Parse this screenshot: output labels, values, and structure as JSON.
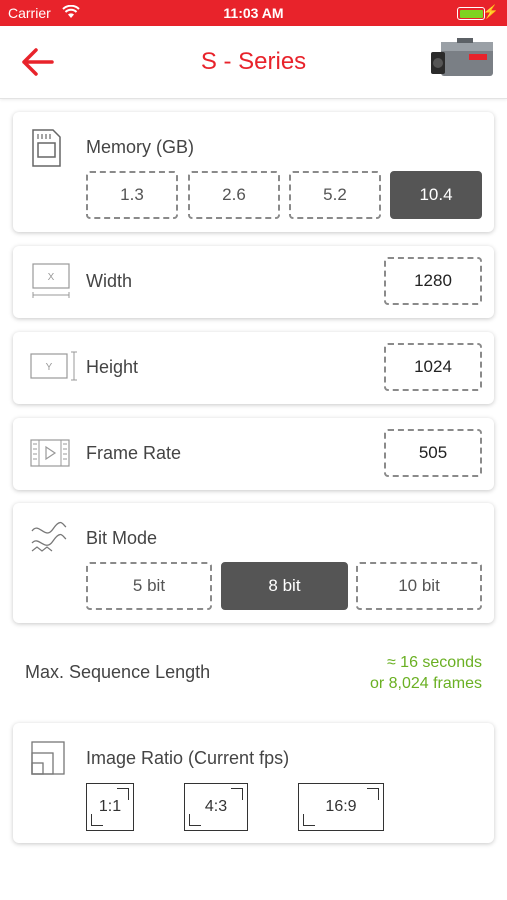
{
  "status_bar": {
    "carrier": "Carrier",
    "time": "11:03 AM"
  },
  "nav": {
    "title": "S - Series"
  },
  "memory": {
    "label": "Memory (GB)",
    "options": [
      "1.3",
      "2.6",
      "5.2",
      "10.4"
    ],
    "selected": "10.4"
  },
  "width": {
    "label": "Width",
    "value": "1280"
  },
  "height": {
    "label": "Height",
    "value": "1024"
  },
  "frame_rate": {
    "label": "Frame Rate",
    "value": "505"
  },
  "bit_mode": {
    "label": "Bit Mode",
    "options": [
      "5 bit",
      "8 bit",
      "10 bit"
    ],
    "selected": "8 bit"
  },
  "sequence": {
    "label": "Max. Sequence Length",
    "line1": "≈ 16 seconds",
    "line2": "or 8,024 frames"
  },
  "image_ratio": {
    "label": "Image Ratio (Current fps)",
    "options": [
      "1:1",
      "4:3",
      "16:9"
    ]
  },
  "icons": {
    "x_icon_text": "X",
    "y_icon_text": "Y"
  },
  "colors": {
    "accent": "#e8232b",
    "selected": "#555555",
    "green": "#6ab023"
  }
}
